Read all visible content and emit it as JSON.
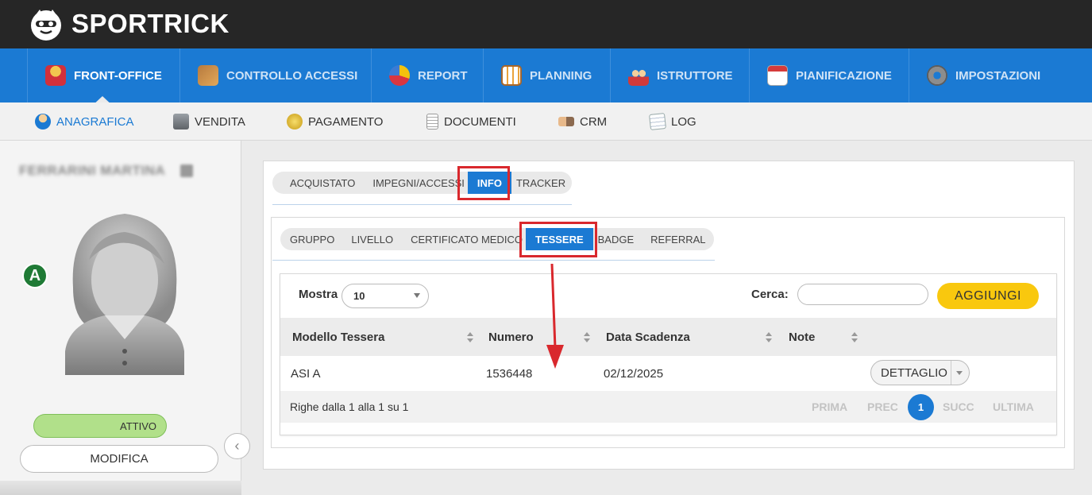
{
  "app": {
    "name": "SPORTRICK"
  },
  "main_nav": [
    {
      "label": "FRONT-OFFICE",
      "icon": "user-icon",
      "active": true
    },
    {
      "label": "CONTROLLO ACCESSI",
      "icon": "access-control-icon"
    },
    {
      "label": "REPORT",
      "icon": "pie-chart-icon"
    },
    {
      "label": "PLANNING",
      "icon": "calendar-grid-icon"
    },
    {
      "label": "ISTRUTTORE",
      "icon": "users-icon"
    },
    {
      "label": "PIANIFICAZIONE",
      "icon": "calendar-icon"
    },
    {
      "label": "IMPOSTAZIONI",
      "icon": "gear-icon"
    }
  ],
  "sub_nav": [
    {
      "label": "ANAGRAFICA",
      "icon": "person-icon",
      "active": true
    },
    {
      "label": "VENDITA",
      "icon": "cash-register-icon"
    },
    {
      "label": "PAGAMENTO",
      "icon": "coin-icon"
    },
    {
      "label": "DOCUMENTI",
      "icon": "document-icon"
    },
    {
      "label": "CRM",
      "icon": "handshake-icon"
    },
    {
      "label": "LOG",
      "icon": "notepad-icon"
    }
  ],
  "profile": {
    "name": "FERRARINI MARTINA",
    "status_letter": "A",
    "status_label": "ATTIVO",
    "edit_label": "MODIFICA"
  },
  "tabs_level1": [
    {
      "label": "ACQUISTATO"
    },
    {
      "label": "IMPEGNI/ACCESSI"
    },
    {
      "label": "INFO",
      "active": true
    },
    {
      "label": "TRACKER"
    }
  ],
  "tabs_level2": [
    {
      "label": "GRUPPO"
    },
    {
      "label": "LIVELLO"
    },
    {
      "label": "CERTIFICATO MEDICO"
    },
    {
      "label": "TESSERE",
      "active": true
    },
    {
      "label": "BADGE"
    },
    {
      "label": "REFERRAL"
    }
  ],
  "table_controls": {
    "show_label": "Mostra",
    "show_value": "10",
    "search_label": "Cerca:",
    "search_value": "",
    "add_label": "AGGIUNGI"
  },
  "table": {
    "columns": [
      "Modello Tessera",
      "Numero",
      "Data Scadenza",
      "Note"
    ],
    "rows": [
      {
        "modello": "ASI A",
        "numero": "1536448",
        "scadenza": "02/12/2025",
        "note": "",
        "action": "DETTAGLIO"
      }
    ],
    "info": "Righe dalla 1 alla 1 su 1",
    "pagination": {
      "first": "PRIMA",
      "prev": "PREC",
      "current": "1",
      "next": "SUCC",
      "last": "ULTIMA"
    }
  },
  "colors": {
    "topbar": "#262626",
    "nav_blue": "#1b7ad3",
    "accent_yellow": "#f9c80e",
    "status_green": "#b1e08a",
    "highlight_red": "#d9282d"
  }
}
